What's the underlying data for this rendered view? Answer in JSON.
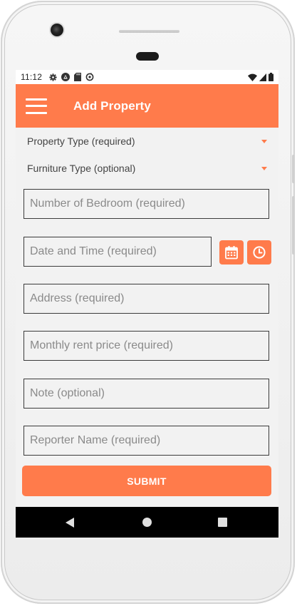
{
  "status_bar": {
    "time": "11:12",
    "notification_icons": [
      "gear-icon",
      "android-icon",
      "sd-card-icon",
      "sync-icon"
    ],
    "system_icons": [
      "wifi-icon",
      "cellular-signal-icon",
      "battery-icon"
    ]
  },
  "app_bar": {
    "title": "Add Property",
    "menu_icon": "hamburger-menu-icon",
    "color": "#ff7b4b"
  },
  "form": {
    "property_type": {
      "label": "Property Type (required)"
    },
    "furniture_type": {
      "label": "Furniture Type (optional)"
    },
    "bedrooms": {
      "placeholder": "Number of Bedroom (required)",
      "value": ""
    },
    "date_time": {
      "placeholder": "Date and Time (required)",
      "value": "",
      "date_icon": "calendar-icon",
      "time_icon": "clock-icon"
    },
    "address": {
      "placeholder": "Address (required)",
      "value": ""
    },
    "rent": {
      "placeholder": "Monthly rent price (required)",
      "value": ""
    },
    "note": {
      "placeholder": "Note (optional)",
      "value": ""
    },
    "reporter": {
      "placeholder": "Reporter Name (required)",
      "value": ""
    },
    "submit_label": "SUBMIT"
  },
  "nav_bar": {
    "icons": [
      "back-icon",
      "home-icon",
      "recents-icon"
    ]
  },
  "colors": {
    "accent": "#ff7b4b",
    "background": "#f2f2f2",
    "field_border": "#3b3b3b",
    "placeholder": "#8a8a8a"
  }
}
